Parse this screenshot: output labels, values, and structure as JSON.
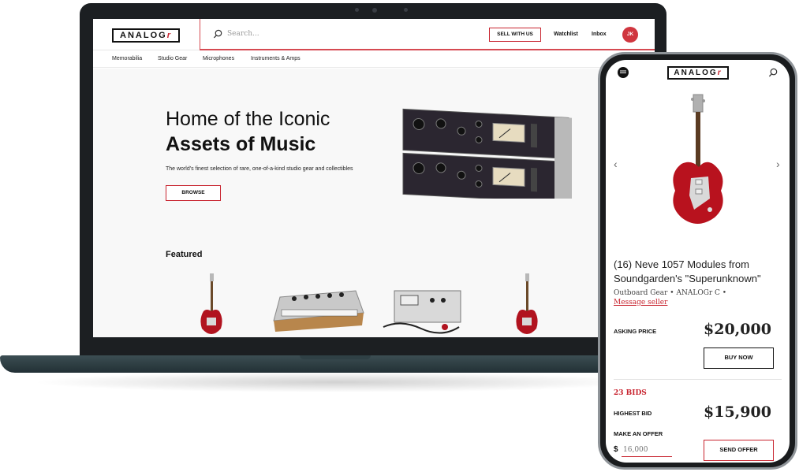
{
  "brand": {
    "logo_main": "ANALOG",
    "logo_accent": "r",
    "accent_color": "#c8242f"
  },
  "desktop": {
    "header": {
      "search_placeholder": "Search...",
      "sell_label": "SELL WITH US",
      "watchlist_label": "Watchlist",
      "inbox_label": "Inbox",
      "avatar_initials": "JK"
    },
    "nav": [
      "Memorabilia",
      "Studio Gear",
      "Microphones",
      "Instruments & Amps"
    ],
    "hero": {
      "title_line1": "Home of the Iconic",
      "title_line2": "Assets of Music",
      "subtitle": "The world's finest selection of rare, one-of-a-kind studio gear and collectibles",
      "browse_label": "BROWSE"
    },
    "featured_title": "Featured"
  },
  "mobile": {
    "product_title": "(16) Neve 1057 Modules from Soundgarden's \"Superunknown\"",
    "meta": "Outboard Gear  •  ANALOGr C  •",
    "message_seller": "Message seller",
    "asking_label": "ASKING PRICE",
    "asking_price": "$20,000",
    "buy_label": "BUY NOW",
    "bids_label": "23 BIDS",
    "highest_label": "HIGHEST BID",
    "highest_price": "$15,900",
    "offer_label": "MAKE AN OFFER",
    "currency": "$",
    "offer_placeholder": "16,000",
    "send_label": "SEND OFFER"
  }
}
